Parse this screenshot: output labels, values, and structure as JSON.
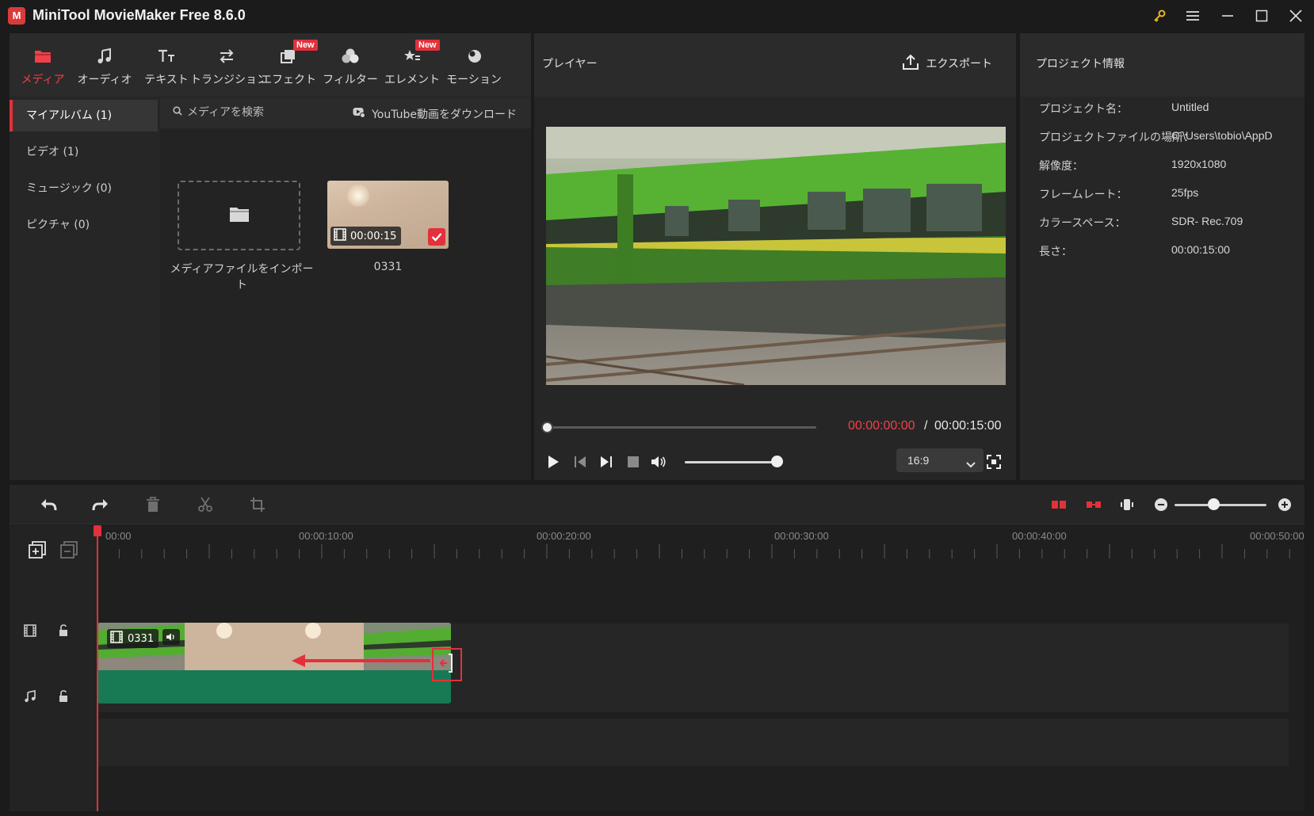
{
  "app": {
    "title": "MiniTool MovieMaker Free 8.6.0",
    "logo_text": "M"
  },
  "window_controls": [
    "key-icon",
    "menu-icon",
    "minimize-icon",
    "maximize-icon",
    "close-icon"
  ],
  "toolbar": {
    "items": [
      {
        "label": "メディア",
        "icon": "media-folder-icon",
        "active": true,
        "badge": ""
      },
      {
        "label": "オーディオ",
        "icon": "music-note-icon",
        "active": false,
        "badge": ""
      },
      {
        "label": "テキスト",
        "icon": "text-icon",
        "active": false,
        "badge": ""
      },
      {
        "label": "トランジション",
        "icon": "transition-icon",
        "active": false,
        "badge": ""
      },
      {
        "label": "エフェクト",
        "icon": "effect-icon",
        "active": false,
        "badge": "New"
      },
      {
        "label": "フィルター",
        "icon": "filter-icon",
        "active": false,
        "badge": ""
      },
      {
        "label": "エレメント",
        "icon": "element-icon",
        "active": false,
        "badge": "New"
      },
      {
        "label": "モーション",
        "icon": "motion-icon",
        "active": false,
        "badge": ""
      }
    ]
  },
  "albums": {
    "items": [
      {
        "label": "マイアルバム (1)",
        "active": true
      },
      {
        "label": "ビデオ (1)",
        "active": false
      },
      {
        "label": "ミュージック (0)",
        "active": false
      },
      {
        "label": "ピクチャ (0)",
        "active": false
      }
    ]
  },
  "media": {
    "search_placeholder": "メディアを検索",
    "youtube_label": "YouTube動画をダウンロード",
    "import_label": "メディアファイルをインポート",
    "clip": {
      "name": "0331",
      "duration": "00:00:15",
      "selected": true
    }
  },
  "player": {
    "title": "プレイヤー",
    "export_label": "エクスポート",
    "time_current": "00:00:00:00",
    "time_separator": "/",
    "time_total": "00:00:15:00",
    "progress": 0,
    "volume": 0.95,
    "aspect_ratio": "16:9"
  },
  "project_info": {
    "title": "プロジェクト情報",
    "rows": [
      {
        "key": "プロジェクト名：",
        "value": "Untitled"
      },
      {
        "key": "プロジェクトファイルの場所：",
        "value": "C:\\Users\\tobio\\AppD"
      },
      {
        "key": "解像度：",
        "value": "1920x1080"
      },
      {
        "key": "フレームレート：",
        "value": "25fps"
      },
      {
        "key": "カラースペース：",
        "value": "SDR- Rec.709"
      },
      {
        "key": "長さ：",
        "value": "00:00:15:00"
      }
    ]
  },
  "timeline": {
    "ruler_labels": [
      "00:00",
      "00:00:10:00",
      "00:00:20:00",
      "00:00:30:00",
      "00:00:40:00",
      "00:00:50:00"
    ],
    "zoom": 0.37,
    "clip": {
      "name": "0331"
    }
  },
  "colors": {
    "accent": "#e2313b",
    "clip_green": "#177a55",
    "background": "#1b1b1b",
    "panel": "#262626"
  }
}
